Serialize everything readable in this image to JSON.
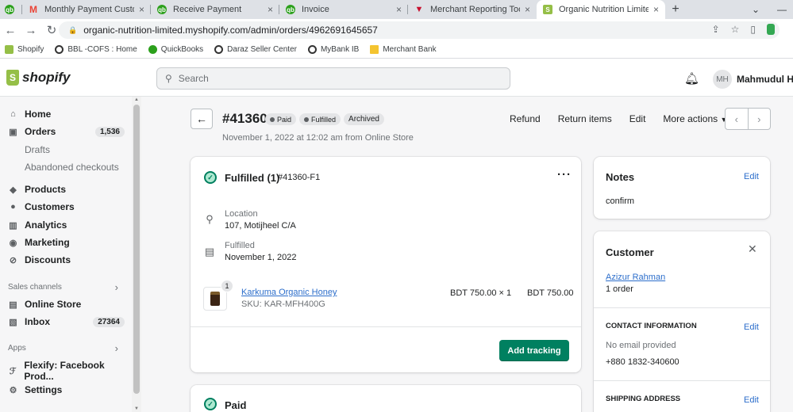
{
  "browser": {
    "tabs": [
      {
        "title": "",
        "favicon_color": "#2ca01c"
      },
      {
        "title": "Monthly Payment Customer",
        "favicon_color": "#ea4335"
      },
      {
        "title": "Receive Payment",
        "favicon_color": "#2ca01c"
      },
      {
        "title": "Invoice",
        "favicon_color": "#2ca01c"
      },
      {
        "title": "Merchant Reporting Tool",
        "favicon_color": "#c8102e"
      },
      {
        "title": "Organic Nutrition Limited",
        "favicon_color": "#95bf47"
      }
    ],
    "url": "organic-nutrition-limited.myshopify.com/admin/orders/4962691645657",
    "bookmarks": [
      {
        "label": "Shopify",
        "color": "#95bf47"
      },
      {
        "label": "BBL -COFS : Home",
        "color": "#333333"
      },
      {
        "label": "QuickBooks",
        "color": "#2ca01c"
      },
      {
        "label": "Daraz Seller Center",
        "color": "#333333"
      },
      {
        "label": "MyBank IB",
        "color": "#333333"
      },
      {
        "label": "Merchant Bank",
        "color": "#f4c430"
      }
    ]
  },
  "topbar": {
    "brand": "shopify",
    "search_placeholder": "Search",
    "avatar_initials": "MH",
    "user_name": "Mahmudul Ha"
  },
  "sidebar": {
    "home": "Home",
    "orders": "Orders",
    "orders_count": "1,536",
    "drafts": "Drafts",
    "abandoned": "Abandoned checkouts",
    "products": "Products",
    "customers": "Customers",
    "analytics": "Analytics",
    "marketing": "Marketing",
    "discounts": "Discounts",
    "sales_channels": "Sales channels",
    "online_store": "Online Store",
    "inbox": "Inbox",
    "inbox_count": "27364",
    "apps": "Apps",
    "flexify": "Flexify: Facebook Prod...",
    "settings": "Settings"
  },
  "order": {
    "number": "#41360",
    "badge_paid": "Paid",
    "badge_fulfilled": "Fulfilled",
    "badge_archived": "Archived",
    "date": "November 1, 2022 at 12:02 am from Online Store",
    "actions": {
      "refund": "Refund",
      "return_items": "Return items",
      "edit": "Edit",
      "more": "More actions"
    }
  },
  "fulfillment": {
    "title": "Fulfilled (1)",
    "id": "#41360-F1",
    "location_label": "Location",
    "location_value": "107, Motijheel C/A",
    "fulfilled_label": "Fulfilled",
    "fulfilled_value": "November 1, 2022",
    "item": {
      "quantity": "1",
      "name": "Karkuma Organic Honey",
      "sku": "SKU: KAR-MFH400G",
      "unit": "BDT 750.00 × 1",
      "total": "BDT 750.00"
    },
    "tracking_button": "Add tracking"
  },
  "paid_card": {
    "title": "Paid"
  },
  "notes": {
    "title": "Notes",
    "edit": "Edit",
    "text": "confirm"
  },
  "customer": {
    "title": "Customer",
    "name": "Azizur Rahman",
    "orders": "1 order",
    "contact_heading": "CONTACT INFORMATION",
    "contact_edit": "Edit",
    "email": "No email provided",
    "phone": "+880 1832-340600",
    "shipping_heading": "SHIPPING ADDRESS",
    "shipping_edit": "Edit"
  }
}
